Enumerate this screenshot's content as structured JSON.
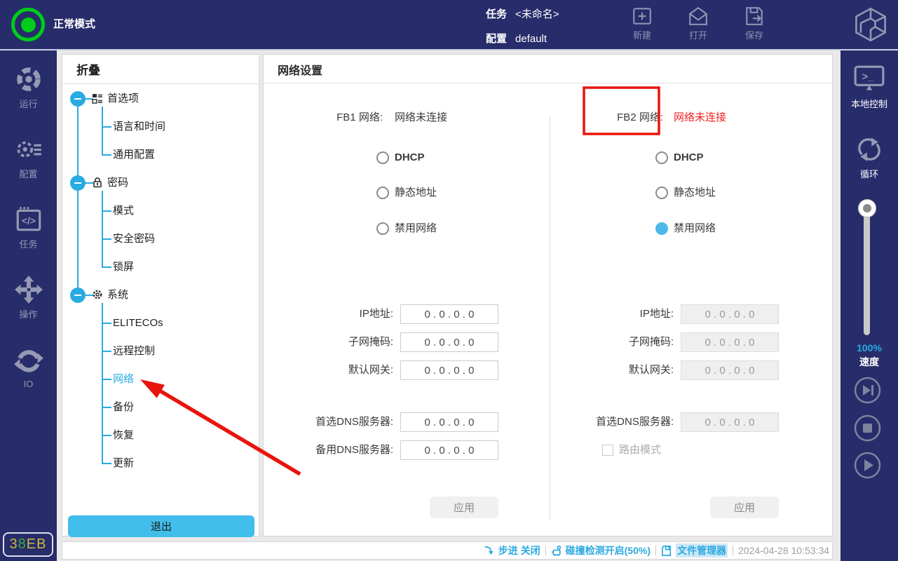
{
  "colors": {
    "topbar_navy": "#272C6A",
    "accent_blue": "#29ABE2",
    "radio_checked_blue": "#4DB8EA",
    "exit_button_blue": "#41BEEB",
    "status_green": "#00CC1B",
    "alert_red": "#E8150D",
    "status_text_cyan": "#2BA9E0"
  },
  "topbar": {
    "mode": "正常模式",
    "task_label": "任务",
    "task_value": "<未命名>",
    "config_label": "配置",
    "config_value": "default",
    "action_new": "新建",
    "action_open": "打开",
    "action_save": "保存"
  },
  "left_sidebar": {
    "items": [
      {
        "label": "运行"
      },
      {
        "label": "配置"
      },
      {
        "label": "任务"
      },
      {
        "label": "操作"
      },
      {
        "label": "IO"
      }
    ],
    "badge": {
      "c0": "3",
      "c1": "8",
      "c2": "E",
      "c3": "B"
    }
  },
  "tree": {
    "collapse": "折叠",
    "sections": [
      {
        "label": "首选项",
        "children": [
          "语言和时间",
          "通用配置"
        ]
      },
      {
        "label": "密码",
        "children": [
          "模式",
          "安全密码",
          "锁屏"
        ]
      },
      {
        "label": "系统",
        "children": [
          "ELITECOs",
          "远程控制",
          "网络",
          "备份",
          "恢复",
          "更新"
        ]
      }
    ],
    "selected_item": "网络",
    "exit": "退出"
  },
  "network": {
    "title": "网络设置",
    "fb1": {
      "name": "FB1 网络:",
      "status": "网络未连接",
      "radio_dhcp": "DHCP",
      "radio_static": "静态地址",
      "radio_disable": "禁用网络",
      "fields": [
        {
          "label": "IP地址:",
          "value": "0 . 0 . 0 . 0"
        },
        {
          "label": "子网掩码:",
          "value": "0 . 0 . 0 . 0"
        },
        {
          "label": "默认网关:",
          "value": "0 . 0 . 0 . 0"
        },
        {
          "label": "首选DNS服务器:",
          "value": "0 . 0 . 0 . 0"
        },
        {
          "label": "备用DNS服务器:",
          "value": "0 . 0 . 0 . 0"
        }
      ],
      "apply": "应用"
    },
    "fb2": {
      "name": "FB2 网络:",
      "status": "网络未连接",
      "radio_dhcp": "DHCP",
      "radio_static": "静态地址",
      "radio_disable": "禁用网络",
      "selected_radio": "禁用网络",
      "fields": [
        {
          "label": "IP地址:",
          "value": "0 . 0 . 0 . 0"
        },
        {
          "label": "子网掩码:",
          "value": "0 . 0 . 0 . 0"
        },
        {
          "label": "默认网关:",
          "value": "0 . 0 . 0 . 0"
        },
        {
          "label": "首选DNS服务器:",
          "value": "0 . 0 . 0 . 0"
        }
      ],
      "route_mode": "路由模式",
      "apply": "应用"
    }
  },
  "right_sidebar": {
    "local_control": "本地控制",
    "loop": "循环",
    "speed_value": "100%",
    "speed_label": "速度"
  },
  "statusbar": {
    "step": "步进 关闭",
    "collision": "碰撞检测开启(50%)",
    "file_manager": "文件管理器",
    "datetime": "2024-04-28 10:53:34"
  }
}
